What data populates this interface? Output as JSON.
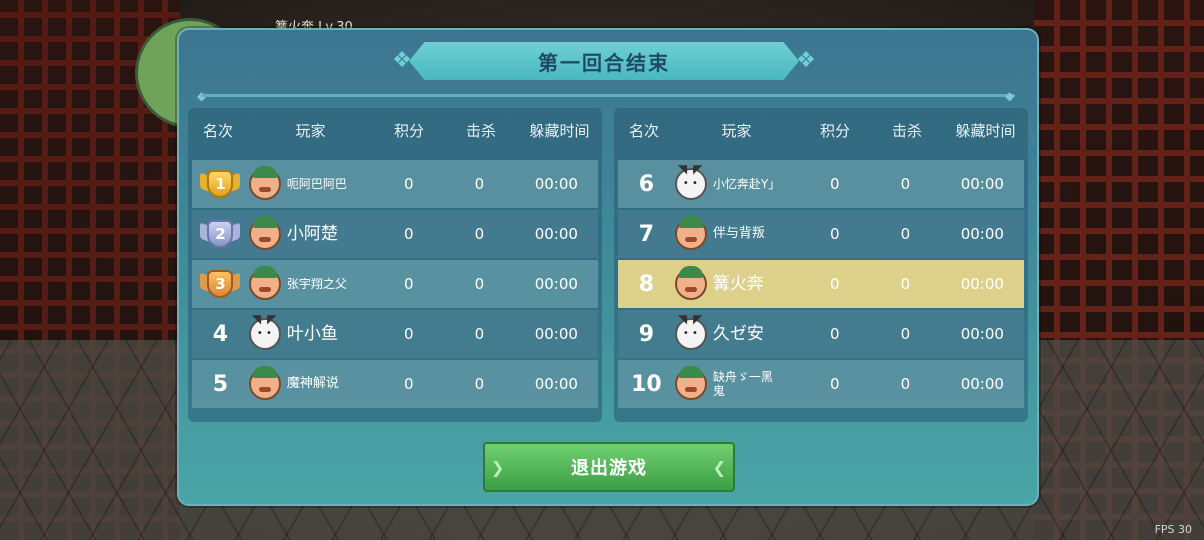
{
  "background": {
    "hud_player_name": "篝火奔 Lv.30",
    "fps": "FPS 30"
  },
  "panel": {
    "title": "第一回合结束",
    "headers": {
      "rank": "名次",
      "player": "玩家",
      "score": "积分",
      "kills": "击杀",
      "hide_time": "躲藏时间"
    },
    "left_rows": [
      {
        "rank": "1",
        "badge": "gold",
        "avatar": "man",
        "name": "呃阿巴阿巴",
        "score": "0",
        "kills": "0",
        "time": "00:00"
      },
      {
        "rank": "2",
        "badge": "silver",
        "avatar": "man",
        "name": "小阿楚",
        "score": "0",
        "kills": "0",
        "time": "00:00"
      },
      {
        "rank": "3",
        "badge": "bronze",
        "avatar": "man",
        "name": "张宇翔之父",
        "score": "0",
        "kills": "0",
        "time": "00:00"
      },
      {
        "rank": "4",
        "badge": "",
        "avatar": "cat",
        "name": "叶小鱼",
        "score": "0",
        "kills": "0",
        "time": "00:00"
      },
      {
        "rank": "5",
        "badge": "",
        "avatar": "man",
        "name": "魔神解说",
        "score": "0",
        "kills": "0",
        "time": "00:00"
      }
    ],
    "right_rows": [
      {
        "rank": "6",
        "avatar": "cat",
        "name": "小忆奔赴Y」",
        "score": "0",
        "kills": "0",
        "time": "00:00",
        "highlight": false
      },
      {
        "rank": "7",
        "avatar": "man",
        "name": "伴与背叛",
        "score": "0",
        "kills": "0",
        "time": "00:00",
        "highlight": false
      },
      {
        "rank": "8",
        "avatar": "man",
        "name": "篝火奔",
        "score": "0",
        "kills": "0",
        "time": "00:00",
        "highlight": true
      },
      {
        "rank": "9",
        "avatar": "cat",
        "name": "久ゼ安",
        "score": "0",
        "kills": "0",
        "time": "00:00",
        "highlight": false
      },
      {
        "rank": "10",
        "avatar": "man",
        "name": "缺舟ゞ一黑鬼",
        "score": "0",
        "kills": "0",
        "time": "00:00",
        "highlight": false
      }
    ],
    "exit_button": "退出游戏"
  },
  "colors": {
    "highlight_row": "#ddd08a",
    "exit_button": "#4fb655",
    "panel": "#3f8a9a"
  }
}
